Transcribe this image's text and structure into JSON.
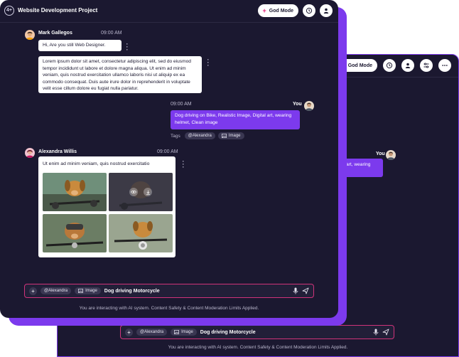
{
  "app": {
    "logo_text": "4+",
    "title": "Website Development Project",
    "god_mode_label": "God Mode"
  },
  "colors": {
    "accent": "#7c3aed",
    "background": "#1b1830",
    "highlight_border": "#d0337a"
  },
  "icons": [
    "history-icon",
    "user-icon",
    "sliders-icon",
    "more-icon",
    "plus-icon",
    "mention-chip",
    "image-icon",
    "mic-icon",
    "send-icon",
    "eye-icon",
    "download-icon"
  ],
  "messages": {
    "m1": {
      "name": "Mark Gallegos",
      "time": "09:00 AM",
      "text_short": "Hi, Are you still Web Designer.",
      "text_long": "Lorem ipsum dolor sit amet, consectetur adipiscing elit, sed do eiusmod tempor incididunt ut labore et dolore magna aliqua. Ut enim ad minim veniam, quis nostrud exercitation ullamco laboris nisi ut aliquip ex ea commodo consequat. Duis aute irure dolor in reprehenderit in voluptate velit esse cillum dolore eu fugiat nulla pariatur."
    },
    "m2": {
      "name": "You",
      "time": "09:00 AM",
      "text": "Dog driving on Bike, Realistic Image, Digital art, wearing helmet, Clean image",
      "tags_label": "Tags",
      "tags": [
        "@Alexandra",
        "Image"
      ]
    },
    "m3": {
      "name": "Alexandra Willis",
      "time": "09:00 AM",
      "caption": "Ut enim ad minim veniam, quis nostrud exercitatio"
    }
  },
  "composer": {
    "chip_mention": "@Alexandra",
    "chip_image": "Image",
    "text": "Dog driving Motorcycle"
  },
  "footer": "You are interacting with AI system. Content Safety & Content Moderation Limits Applied.",
  "back_window": {
    "god_mode_label": "God Mode",
    "you_label": "You",
    "bubble_fragment": "art, wearing",
    "composer": {
      "chip_mention": "@Alexandra",
      "chip_image": "Image",
      "text": "Dog driving Motorcycle"
    },
    "footer": "You are interacting with AI system. Content Safety & Content Moderation Limits Applied."
  }
}
